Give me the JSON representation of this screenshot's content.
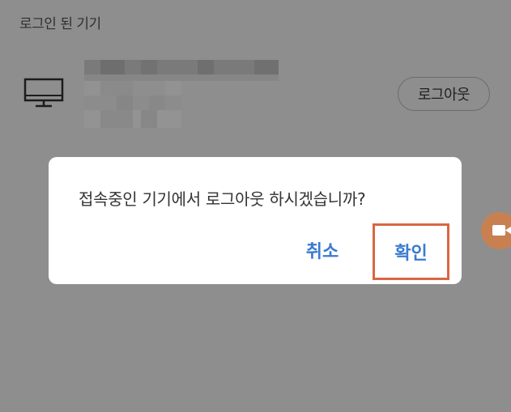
{
  "section": {
    "title": "로그인 된 기기"
  },
  "device": {
    "icon": "monitor-icon",
    "logout_label": "로그아웃"
  },
  "dialog": {
    "message": "접속중인 기기에서 로그아웃 하시겠습니까?",
    "cancel_label": "취소",
    "confirm_label": "확인"
  },
  "floating": {
    "icon": "video-camera-icon"
  },
  "colors": {
    "overlay": "#8e8e8e",
    "accent": "#3a7bd0",
    "highlight": "#d96644",
    "float_button": "#c98051"
  }
}
